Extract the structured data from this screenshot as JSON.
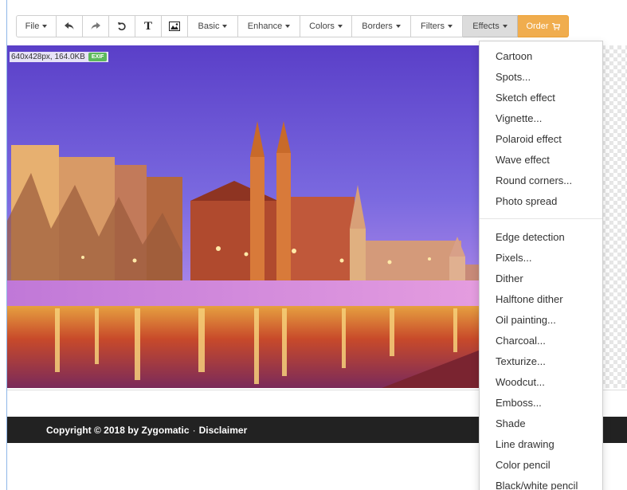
{
  "toolbar": {
    "file_label": "File",
    "text_tool_glyph": "T",
    "basic_label": "Basic",
    "enhance_label": "Enhance",
    "colors_label": "Colors",
    "borders_label": "Borders",
    "filters_label": "Filters",
    "effects_label": "Effects",
    "order_label": "Order",
    "icons": {
      "undo": "undo-icon",
      "redo": "redo-icon",
      "rotate": "rotate-icon",
      "text": "text-icon",
      "image": "image-icon",
      "cart": "cart-icon"
    },
    "order_color": "#f0ad4e"
  },
  "image": {
    "info": "640x428px, 164.0KB",
    "exif_badge": "EXIF"
  },
  "footer": {
    "copyright": "Copyright © 2018 by Zygomatic",
    "separator": "·",
    "disclaimer": "Disclaimer"
  },
  "effects_menu": {
    "group1": [
      "Cartoon",
      "Spots...",
      "Sketch effect",
      "Vignette...",
      "Polaroid effect",
      "Wave effect",
      "Round corners...",
      "Photo spread"
    ],
    "group2": [
      "Edge detection",
      "Pixels...",
      "Dither",
      "Halftone dither",
      "Oil painting...",
      "Charcoal...",
      "Texturize...",
      "Woodcut...",
      "Emboss...",
      "Shade",
      "Line drawing",
      "Color pencil",
      "Black/white pencil"
    ]
  }
}
